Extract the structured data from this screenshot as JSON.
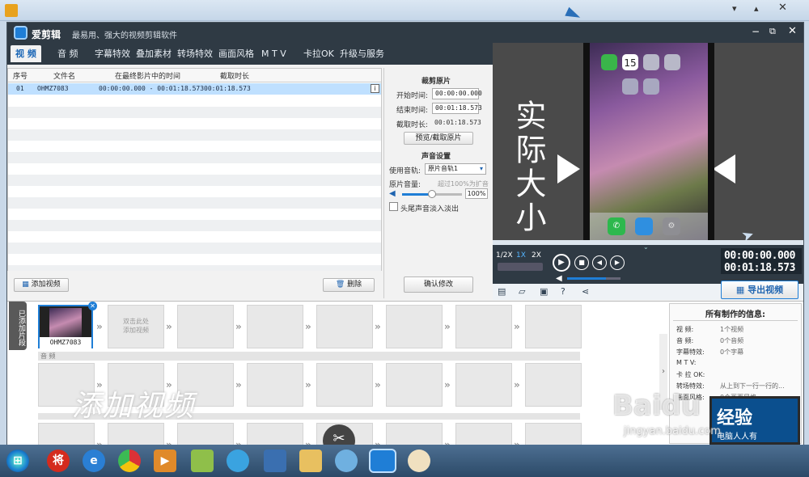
{
  "app": {
    "name": "爱剪辑",
    "tagline": "最易用、强大的视频剪辑软件"
  },
  "tabs": [
    "视 频",
    "音 频",
    "字幕特效",
    "叠加素材",
    "转场特效",
    "画面风格",
    "M T V",
    "卡拉OK",
    "升级与服务"
  ],
  "table": {
    "headers": [
      "序号",
      "文件名",
      "在最终影片中的时间",
      "截取时长"
    ],
    "rows": [
      {
        "no": "01",
        "file": "OHMZ7083",
        "time": "00:00:00.000 - 00:01:18.573",
        "dur": "00:01:18.573"
      }
    ]
  },
  "buttons": {
    "add_video": "添加视频",
    "delete": "删除",
    "preview_clip": "预览/截取原片",
    "confirm": "确认修改",
    "export": "导出视频"
  },
  "clip": {
    "section": "裁剪原片",
    "start_label": "开始时间:",
    "start": "00:00:00.000",
    "end_label": "结束时间:",
    "end": "00:01:18.573",
    "dur_label": "截取时长:",
    "dur": "00:01:18.573"
  },
  "audio": {
    "section": "声音设置",
    "track_label": "使用音轨:",
    "track": "原片音轨1",
    "vol_label": "原片音量:",
    "vol_hint": "超过100%为扩音",
    "vol": "100%",
    "vol_level": 0.5,
    "fade": "头尾声音淡入淡出"
  },
  "preview": {
    "overlay": "实际大小",
    "calendar_day": "15"
  },
  "controls": {
    "speeds": [
      "1/2X",
      "1X",
      "2X"
    ],
    "time_current": "00:00:00.000",
    "time_total": "00:01:18.573",
    "progress": 0.0,
    "volume_level": 0.72
  },
  "timeline": {
    "side_label": "已添加片段",
    "clip_name": "OHMZ7083",
    "add_hint": "双击此处\n添加视频",
    "audio_label": "音 频",
    "watermark": "添加视频"
  },
  "info": {
    "title": "所有制作的信息:",
    "rows": [
      [
        "视    频:",
        "1个视频"
      ],
      [
        "音    频:",
        "0个音频"
      ],
      [
        "字幕特效:",
        "0个字幕"
      ],
      [
        "M  T  V:",
        ""
      ],
      [
        "卡 拉 OK:",
        ""
      ],
      [
        "转场特效:",
        "从上到下一行一行的..."
      ],
      [
        "画面风格:",
        "0个画面风格"
      ]
    ]
  },
  "watermarks": {
    "baidu": "Baidu",
    "jingyan": "经验",
    "site": "jingyan.baidu.com",
    "laptop": "电脑人人有"
  },
  "taskbar": {
    "apps": [
      "start",
      "jiang",
      "ie",
      "chrome",
      "player",
      "folder-green",
      "globe",
      "monitor",
      "explorer",
      "star",
      "aijianji",
      "paint"
    ]
  }
}
